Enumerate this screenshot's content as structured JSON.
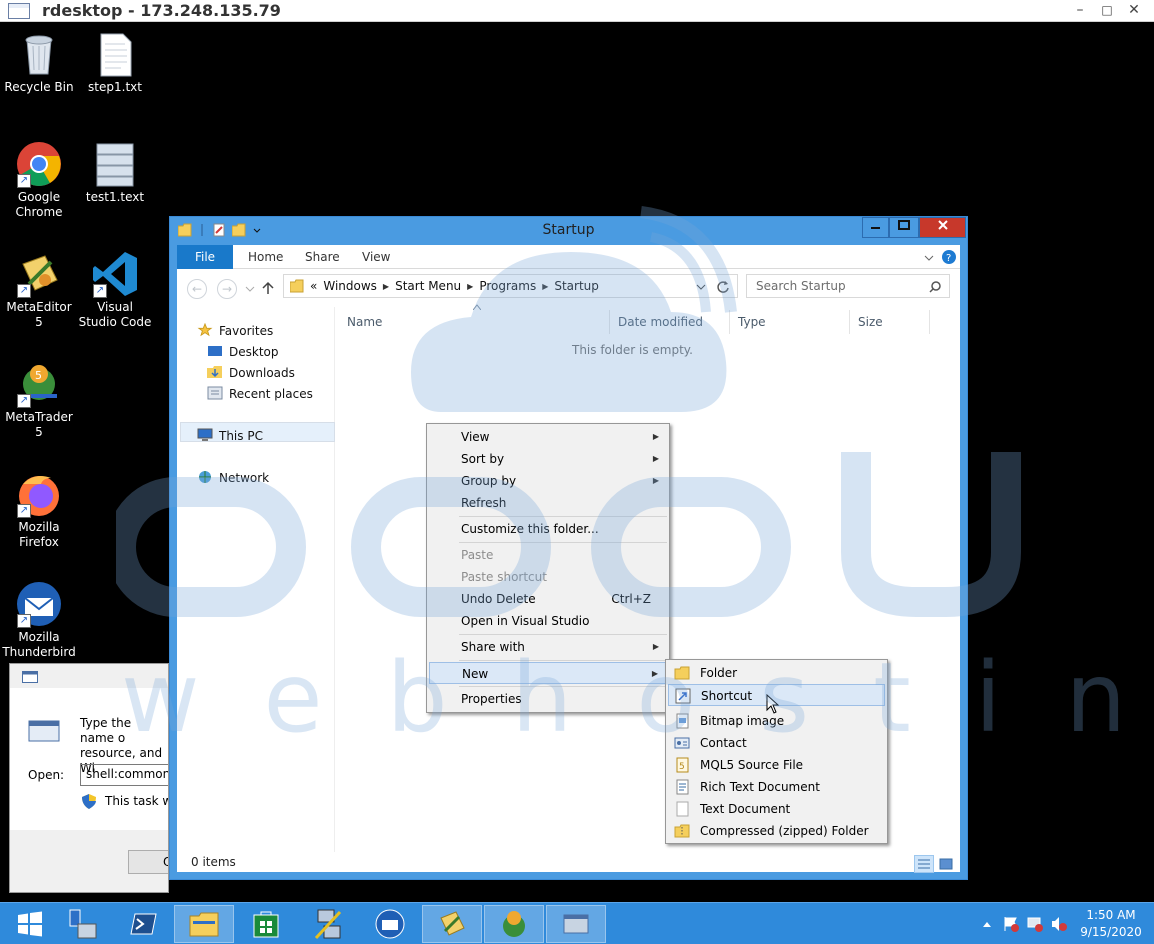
{
  "rdesktop": {
    "title": "rdesktop - 173.248.135.79",
    "minimize": "–",
    "maximize": "□",
    "close": "✕"
  },
  "desktop_icons": [
    {
      "label": "Recycle Bin"
    },
    {
      "label": "step1.txt"
    },
    {
      "label": "Google Chrome"
    },
    {
      "label": "test1.text"
    },
    {
      "label": "MetaEditor 5"
    },
    {
      "label": "Visual Studio Code"
    },
    {
      "label": "MetaTrader 5"
    },
    {
      "label": "Mozilla Firefox"
    },
    {
      "label": "Mozilla Thunderbird"
    }
  ],
  "explorer": {
    "title": "Startup",
    "ribbon_tabs": [
      "File",
      "Home",
      "Share",
      "View"
    ],
    "address": {
      "prefix": "«",
      "segments": [
        "Windows",
        "Start Menu",
        "Programs",
        "Startup"
      ]
    },
    "search_placeholder": "Search Startup",
    "nav": {
      "favorites": "Favorites",
      "desktop": "Desktop",
      "downloads": "Downloads",
      "recent": "Recent places",
      "this_pc": "This PC",
      "network": "Network"
    },
    "columns": [
      "Name",
      "Date modified",
      "Type",
      "Size"
    ],
    "empty_message": "This folder is empty.",
    "status": "0 items"
  },
  "context_menu": {
    "items": [
      {
        "label": "View",
        "submenu": true
      },
      {
        "label": "Sort by",
        "submenu": true
      },
      {
        "label": "Group by",
        "submenu": true
      },
      {
        "label": "Refresh"
      },
      {
        "label": "Customize this folder..."
      },
      {
        "label": "Paste",
        "disabled": true
      },
      {
        "label": "Paste shortcut",
        "disabled": true
      },
      {
        "label": "Undo Delete",
        "shortcut": "Ctrl+Z"
      },
      {
        "label": "Open in Visual Studio"
      },
      {
        "label": "Share with",
        "submenu": true
      },
      {
        "label": "New",
        "submenu": true,
        "highlighted": true
      },
      {
        "label": "Properties"
      }
    ]
  },
  "new_submenu": {
    "items": [
      {
        "label": "Folder",
        "icon": "folder-icon"
      },
      {
        "label": "Shortcut",
        "icon": "shortcut-icon",
        "highlighted": true
      },
      {
        "label": "Bitmap image",
        "icon": "bitmap-icon"
      },
      {
        "label": "Contact",
        "icon": "contact-icon"
      },
      {
        "label": "MQL5 Source File",
        "icon": "mql5-icon"
      },
      {
        "label": "Rich Text Document",
        "icon": "rtf-icon"
      },
      {
        "label": "Text Document",
        "icon": "text-document-icon"
      },
      {
        "label": "Compressed (zipped) Folder",
        "icon": "zip-folder-icon"
      }
    ]
  },
  "run_dialog": {
    "description_line1": "Type the name o",
    "description_line2": "resource, and Wi",
    "open_label": "Open:",
    "open_value": "shell:common s",
    "admin_note": "This task wil",
    "ok_button": "O"
  },
  "taskbar": {
    "time": "1:50 AM",
    "date": "9/15/2020"
  },
  "watermark": {
    "text": "webhosting"
  },
  "colors": {
    "taskbar": "#2f8adb",
    "explorer_frame": "#4a9be1",
    "file_tab": "#1979ca",
    "menu_highlight": "#dbe8f7"
  }
}
